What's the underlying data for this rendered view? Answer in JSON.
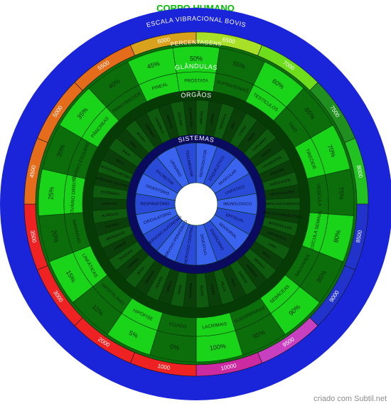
{
  "title": "CORPO HUMANO",
  "footer": "criado com Subtil.net",
  "colors": {
    "outer_blue": "#1a24d8",
    "ring_green": "#0d9a0d",
    "band_bright": "#19d419",
    "band_dark": "#0b6e0b",
    "teal": "#1b7878",
    "dark_ring": "#063b06",
    "black_ring": "#0a0a0a",
    "navy": "#0a0a5e",
    "systems_blue": "#2f54e8",
    "white": "#ffffff"
  },
  "rings": [
    {
      "id": "escala",
      "title": "ESCALA VIBRACIONAL BOVIS",
      "items": [
        {
          "label": "6000",
          "color": "#d9a21c"
        },
        {
          "label": "6500",
          "color": "#a8e028"
        },
        {
          "label": "7000",
          "color": "#6ede1c"
        },
        {
          "label": "7500",
          "color": "#1f8f1f"
        },
        {
          "label": "8000",
          "color": "#22c222"
        },
        {
          "label": "8500",
          "color": "#2233cc"
        },
        {
          "label": "9000",
          "color": "#2233cc"
        },
        {
          "label": "9500",
          "color": "#c840c0"
        },
        {
          "label": "10000",
          "color": "#cc2aa0"
        },
        {
          "label": "1000",
          "color": "#ee2222"
        },
        {
          "label": "2000",
          "color": "#ee2222"
        },
        {
          "label": "3000",
          "color": "#ee2222"
        },
        {
          "label": "3500",
          "color": "#ee2222"
        },
        {
          "label": "4500",
          "color": "#e46c1a"
        },
        {
          "label": "5000",
          "color": "#e46c1a"
        },
        {
          "label": "5500",
          "color": "#e46c1a"
        }
      ]
    },
    {
      "id": "percentagens",
      "title": "PERCENTAGENS",
      "items": [
        "50%",
        "55%",
        "60%",
        "65%",
        "70%",
        "75%",
        "80%",
        "85%",
        "90%",
        "95%",
        "100%",
        "0%",
        "5%",
        "10%",
        "15%",
        "20%",
        "25%",
        "30%",
        "35%",
        "40%",
        "45%"
      ]
    },
    {
      "id": "glandulas",
      "title": "GLÂNDULAS",
      "items": [
        "PRÓSTATA",
        "SUPRARENAIS",
        "TESTÍCULOS",
        "TIMO",
        "TIREÓIDE",
        "VESÍCULA",
        "VESÍCULA SEMINAL",
        "SALIVARES",
        "SEBÁCEAS",
        "SUDORÍPARAS",
        "LACRIMAIS",
        "FÍGADO",
        "HIPÓFISE",
        "HIPOTÁLAMO",
        "LINFÁTICAS",
        "MAMÁRIAS",
        "OVÁRIO DIREITO",
        "OVÁRIO ESQUERDO",
        "PÂNCREAS",
        "PARATIREÓIDE",
        "PINEAL"
      ]
    },
    {
      "id": "orgaos",
      "title": "ÓRGÃOS",
      "items": [
        "URETRA",
        "VAGINA",
        "VESÍCULA",
        "VEIA",
        "ÚTERO",
        "VASOS",
        "CAPILARES",
        "OSSOS",
        "LIGAMENTOS",
        "TENDÕES",
        "CARTILAGEM",
        "ARTICULAÇÕES",
        "MÚSCULO CARDÍACO",
        "MÚSCULO ESQUELÉTICO",
        "MÚSCULO LISO",
        "LINFONODOS",
        "LINFA",
        "BAÇO",
        "MEDULA",
        "ARTÉRIAS",
        "SANGUE",
        "PELE",
        "PÊLOS",
        "UNHAS",
        "OLHOS",
        "OUVIDOS",
        "NARIZ",
        "LÍNGUA",
        "DENTES",
        "GENGIVA",
        "BOCA",
        "FARINGE",
        "TRAQUEIA",
        "LARINGE",
        "BRÔNQUIOS",
        "PULMÃO",
        "ALVÉOLOS",
        "ESÔFAGO",
        "ESTÔMAGO",
        "INTESTINO DELGADO",
        "INTESTINO GROSSO",
        "RETO",
        "ÂNUS",
        "RINS",
        "BEXIGA",
        "CÉREBRO",
        "CEREBELO",
        "NERVOS",
        "COLUNA",
        "DIAFRAGMA"
      ]
    },
    {
      "id": "sistemas",
      "title": "SISTEMAS",
      "items": [
        "REPRODUTOR",
        "ESQUELÉTICO",
        "MUSCULAR",
        "LINFÁTICO",
        "IMUNOLÓGICO",
        "EPITELIAL",
        "SENSORIAL",
        "ENDÓCRINO",
        "DIGESTIVO",
        "NERVOSO CENTRAL",
        "NERVOSO PERIFÉRICO",
        "NERVOSO AUTÔNOMO",
        "CIRCULATÓRIO",
        "RESPIRATÓRIO",
        "DIGESTÓRIO",
        "EXCRETOR",
        "URINÁRIO",
        "TEGUMENTAR"
      ]
    }
  ]
}
